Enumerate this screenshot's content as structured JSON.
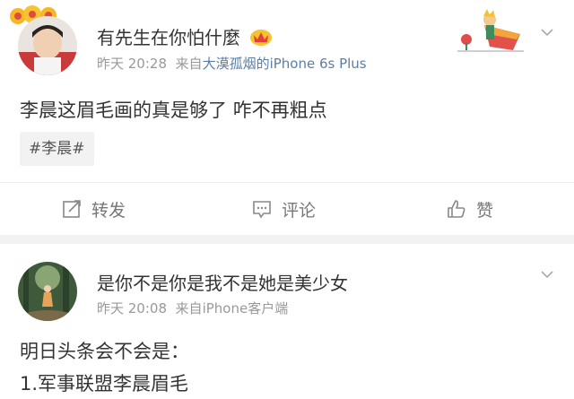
{
  "post1": {
    "user_name": "有先生在你怕什麼",
    "time": "昨天 20:28",
    "source_prefix": "来自",
    "source": "大漠孤烟的iPhone 6s Plus",
    "text": "李晨这眉毛画的真是够了 咋不再粗点",
    "topic": "#李晨#",
    "actions": {
      "repost": "转发",
      "comment": "评论",
      "like": "赞"
    }
  },
  "post2": {
    "user_name": "是你不是你是我不是她是美少女",
    "time": "昨天 20:08",
    "source_prefix": "来自",
    "source": "iPhone客户端",
    "lines": [
      "明日头条会不会是：",
      "1.军事联盟李晨眉毛"
    ]
  },
  "colors": {
    "link": "#5b7ea7",
    "meta": "#999999",
    "text": "#333333"
  }
}
